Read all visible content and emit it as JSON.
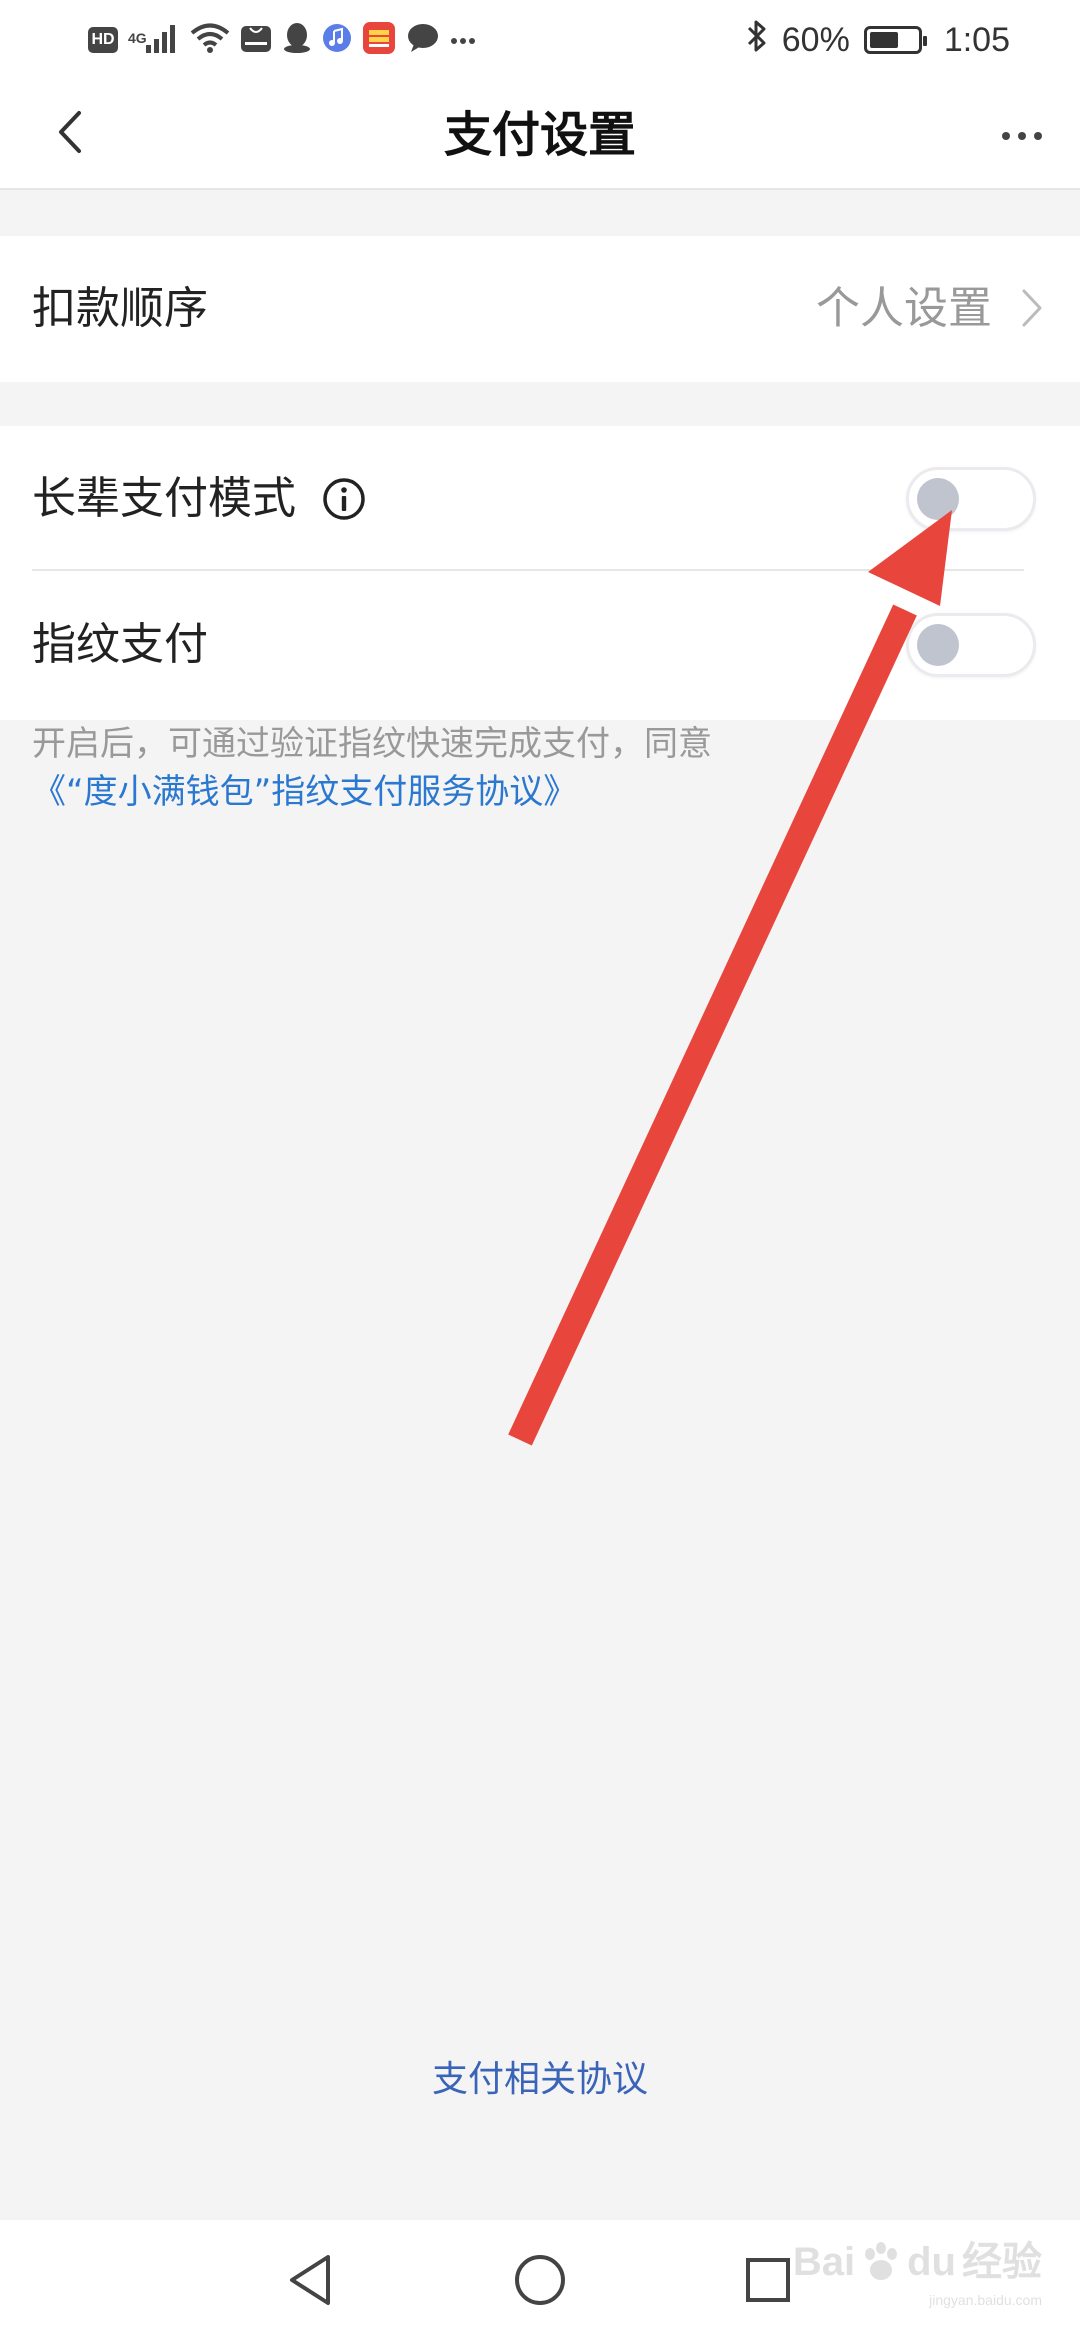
{
  "status_bar": {
    "left_icons": [
      "hd-icon",
      "signal-4g-icon",
      "wifi-icon",
      "huawei-store-icon",
      "qq-icon",
      "music-icon",
      "app-icon",
      "message-icon",
      "more-notifications-icon"
    ],
    "battery_percent": "60%",
    "battery_level": 0.6,
    "time": "1:05"
  },
  "nav": {
    "title": "支付设置"
  },
  "deduction": {
    "label": "扣款顺序",
    "value": "个人设置"
  },
  "elder_mode": {
    "label": "长辈支付模式",
    "enabled": false
  },
  "fingerprint": {
    "label": "指纹支付",
    "enabled": false
  },
  "note": {
    "text": "开启后，可通过验证指纹快速完成支付，同意",
    "link": "《“度小满钱包”指纹支付服务协议》"
  },
  "footer": {
    "link": "支付相关协议"
  },
  "annotation": {
    "arrow_color": "#e8453c"
  },
  "watermark": {
    "brand": "Bai",
    "brand_suffix": "du",
    "chinese": "经验",
    "url": "jingyan.baidu.com"
  }
}
